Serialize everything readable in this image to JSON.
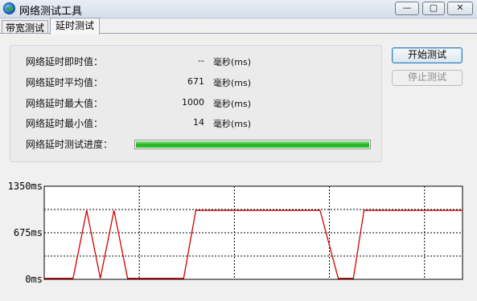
{
  "window": {
    "title": "网络测试工具",
    "minimize_glyph": "—",
    "maximize_glyph": "▢",
    "close_glyph": "✕"
  },
  "tabs": [
    {
      "label": "带宽测试",
      "active": false
    },
    {
      "label": "延时测试",
      "active": true
    }
  ],
  "stats": {
    "current": {
      "label": "网络延时即时值：",
      "value": "--",
      "unit": "毫秒(ms)"
    },
    "average": {
      "label": "网络延时平均值：",
      "value": "671",
      "unit": "毫秒(ms)"
    },
    "max": {
      "label": "网络延时最大值：",
      "value": "1000",
      "unit": "毫秒(ms)"
    },
    "min": {
      "label": "网络延时最小值：",
      "value": "14",
      "unit": "毫秒(ms)"
    },
    "progress": {
      "label": "网络延时测试进度：",
      "fraction": 1.0
    }
  },
  "buttons": {
    "start": "开始测试",
    "stop": "停止测试"
  },
  "colors": {
    "trace": "#d40000",
    "progress_green": "#1fb21d"
  },
  "chart_data": {
    "type": "line",
    "y_tick_labels": [
      "1350ms",
      "675ms",
      "0ms"
    ],
    "ylim": [
      0,
      1350
    ],
    "grid": true,
    "series": [
      {
        "x": [
          0,
          19,
          28,
          37,
          46,
          55,
          64,
          92,
          100,
          182,
          194,
          204,
          211,
          220,
          276
        ],
        "y": [
          14,
          14,
          1000,
          14,
          1000,
          14,
          14,
          14,
          1000,
          1000,
          14,
          14,
          1000,
          1000,
          1000
        ]
      }
    ]
  }
}
